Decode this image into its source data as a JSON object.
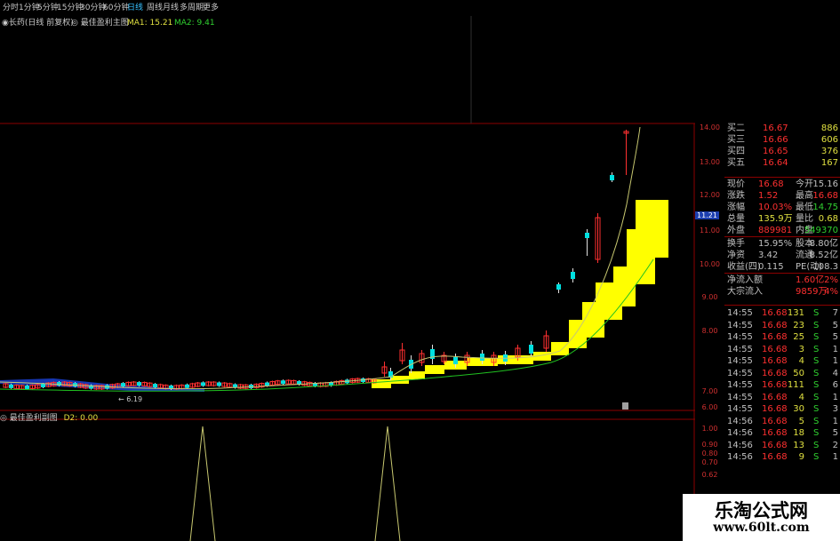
{
  "toolbar": {
    "items": [
      {
        "label": "分时"
      },
      {
        "label": "1分钟"
      },
      {
        "label": "5分钟"
      },
      {
        "label": "15分钟"
      },
      {
        "label": "30分钟"
      },
      {
        "label": "60分钟"
      },
      {
        "label": "日线",
        "active": true
      },
      {
        "label": "周线"
      },
      {
        "label": "月线"
      },
      {
        "label": "多周期"
      },
      {
        "label": "更多"
      }
    ]
  },
  "title": {
    "stock": "◉长药(日线 前复权)",
    "indicator": "◎ 最佳盈利主图",
    "ma1": "MA1: 15.21",
    "ma2": "MA2: 9.41"
  },
  "price_axis": {
    "labels": [
      "14.00",
      "13.00",
      "12.00",
      "11.00",
      "10.00",
      "9.00",
      "8.00",
      "7.00",
      "6.00"
    ],
    "current": "11.21"
  },
  "low_marker": "← 6.19",
  "sub_chart": {
    "title": "◎ 最佳盈利副图",
    "value": "D2: 0.00",
    "axis_labels": [
      "1.00",
      "0.90",
      "0.80",
      "0.70",
      "0.62"
    ]
  },
  "quote": {
    "bids": [
      {
        "label": "买二",
        "price": "16.67",
        "vol": "886"
      },
      {
        "label": "买三",
        "price": "16.66",
        "vol": "606"
      },
      {
        "label": "买四",
        "price": "16.65",
        "vol": "376"
      },
      {
        "label": "买五",
        "price": "16.64",
        "vol": "167"
      }
    ],
    "stats": [
      {
        "l1": "现价",
        "v1": "16.68",
        "l2": "今开",
        "v2": "15.16"
      },
      {
        "l1": "涨跌",
        "v1": "1.52",
        "l2": "最高",
        "v2": "16.68"
      },
      {
        "l1": "涨幅",
        "v1": "10.03%",
        "l2": "最低",
        "v2": "14.75"
      },
      {
        "l1": "总量",
        "v1": "135.9万",
        "l2": "量比",
        "v2": "0.68"
      },
      {
        "l1": "外盘",
        "v1": "889981",
        "l2": "内盘",
        "v2": "549370"
      },
      {
        "l1": "换手",
        "v1": "15.95%",
        "l2": "股本",
        "v2": "8.80亿"
      },
      {
        "l1": "净资",
        "v1": "3.42",
        "l2": "流通",
        "v2": "8.52亿"
      },
      {
        "l1": "收益(四)",
        "v1": "0.115",
        "l2": "PE(动)",
        "v2": "108.3"
      }
    ],
    "flows": [
      {
        "label": "净流入额",
        "value": "1.60亿",
        "pct": "2%"
      },
      {
        "label": "大宗流入",
        "value": "9859万",
        "pct": "4%"
      }
    ],
    "ticks": [
      {
        "time": "14:55",
        "price": "16.68",
        "vol": "131",
        "side": "S",
        "n": "7"
      },
      {
        "time": "14:55",
        "price": "16.68",
        "vol": "23",
        "side": "S",
        "n": "5"
      },
      {
        "time": "14:55",
        "price": "16.68",
        "vol": "25",
        "side": "S",
        "n": "5"
      },
      {
        "time": "14:55",
        "price": "16.68",
        "vol": "3",
        "side": "S",
        "n": "1"
      },
      {
        "time": "14:55",
        "price": "16.68",
        "vol": "4",
        "side": "S",
        "n": "1"
      },
      {
        "time": "14:55",
        "price": "16.68",
        "vol": "50",
        "side": "S",
        "n": "4"
      },
      {
        "time": "14:55",
        "price": "16.68",
        "vol": "111",
        "side": "S",
        "n": "6"
      },
      {
        "time": "14:55",
        "price": "16.68",
        "vol": "4",
        "side": "S",
        "n": "1"
      },
      {
        "time": "14:55",
        "price": "16.68",
        "vol": "30",
        "side": "S",
        "n": "3"
      },
      {
        "time": "14:56",
        "price": "16.68",
        "vol": "5",
        "side": "S",
        "n": "1"
      },
      {
        "time": "14:56",
        "price": "16.68",
        "vol": "18",
        "side": "S",
        "n": "5"
      },
      {
        "time": "14:56",
        "price": "16.68",
        "vol": "13",
        "side": "S",
        "n": "2"
      },
      {
        "time": "14:56",
        "price": "16.68",
        "vol": "9",
        "side": "S",
        "n": "1"
      }
    ]
  },
  "watermark": {
    "line1": "乐淘公式网",
    "line2": "www.60lt.com"
  },
  "colors": {
    "up": "#ff3030",
    "down": "#00e0e0",
    "ma1": "#c8c870",
    "ma2": "#20c020",
    "band": "#ffff00",
    "grid": "#8b0000"
  }
}
